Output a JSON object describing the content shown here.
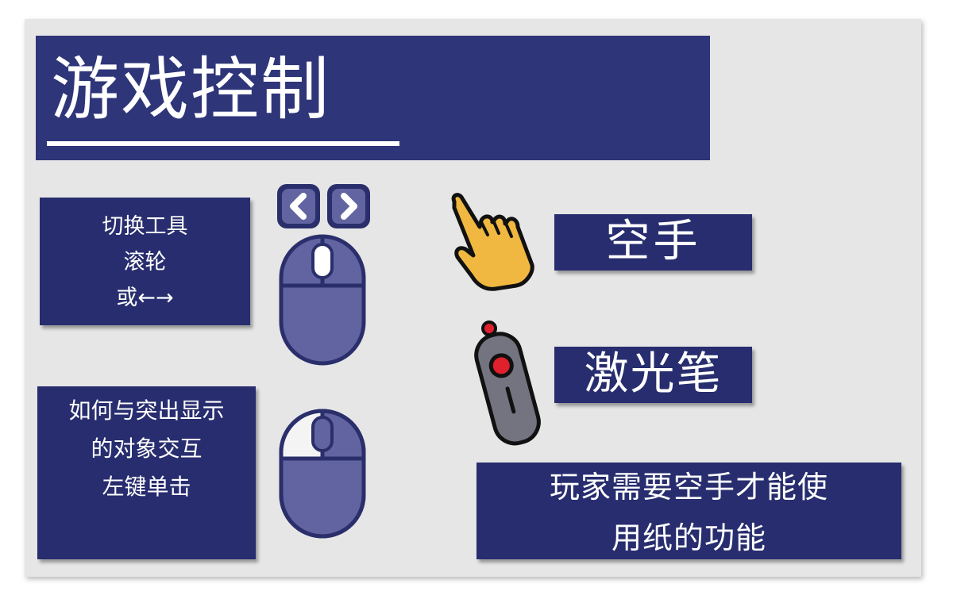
{
  "title": "游戏控制",
  "switch_tool": {
    "line1": "切换工具",
    "line2": "滚轮",
    "line3": "或←→"
  },
  "interact": {
    "line1": "如何与突出显示",
    "line2": "的对象交互",
    "line3": "左键单击"
  },
  "empty_hand_label": "空手",
  "laser_pointer_label": "激光笔",
  "note": {
    "line1": "玩家需要空手才能使",
    "line2": "用纸的功能"
  },
  "colors": {
    "panel": "#272d6e",
    "title_panel": "#2e3578",
    "mouse_body": "#6164a0",
    "mouse_outline": "#2a2f6b",
    "hand": "#f0b840",
    "laser_body": "#737480",
    "laser_red": "#e0202c"
  },
  "icons": [
    "arrow-left-key-icon",
    "arrow-right-key-icon",
    "mouse-scroll-icon",
    "mouse-left-click-icon",
    "pointing-hand-icon",
    "laser-pointer-icon"
  ]
}
